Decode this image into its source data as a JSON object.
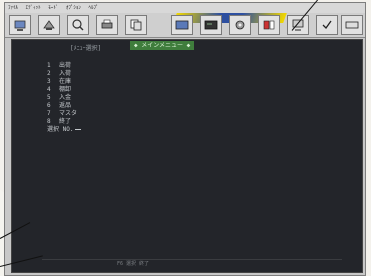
{
  "menubar": {
    "items": [
      "ﾌｧｲﾙ",
      "ｴﾃﾞｨｯﾄ",
      "ﾓｰﾄﾞ",
      "ｵﾌﾟｼｮﾝ",
      "ﾍﾙﾌﾟ"
    ]
  },
  "toolbar": {
    "icons": [
      "connect-icon",
      "disconnect-icon",
      "search-icon",
      "print-icon",
      "copy-icon",
      "window-icon",
      "terminal-icon",
      "settings-icon",
      "transfer-icon",
      "screen-icon",
      "check-icon",
      "keyboard-icon"
    ]
  },
  "terminal": {
    "mode_label": "[ﾒﾆｭｰ選択]",
    "title": "◆ メインメニュー ◆",
    "items": [
      {
        "num": "1",
        "label": "出荷"
      },
      {
        "num": "2",
        "label": "入荷"
      },
      {
        "num": "3",
        "label": "在庫"
      },
      {
        "num": "4",
        "label": "棚卸"
      },
      {
        "num": "5",
        "label": "入金"
      },
      {
        "num": "6",
        "label": "返品"
      },
      {
        "num": "7",
        "label": "マスタ"
      },
      {
        "num": "8",
        "label": "終了"
      }
    ],
    "prompt": "選択 NO.",
    "status": "F6 選択 終了"
  },
  "colors": {
    "terminal_bg": "#23252a",
    "title_bg": "#3f7d3c",
    "text": "#c4c8cc"
  }
}
